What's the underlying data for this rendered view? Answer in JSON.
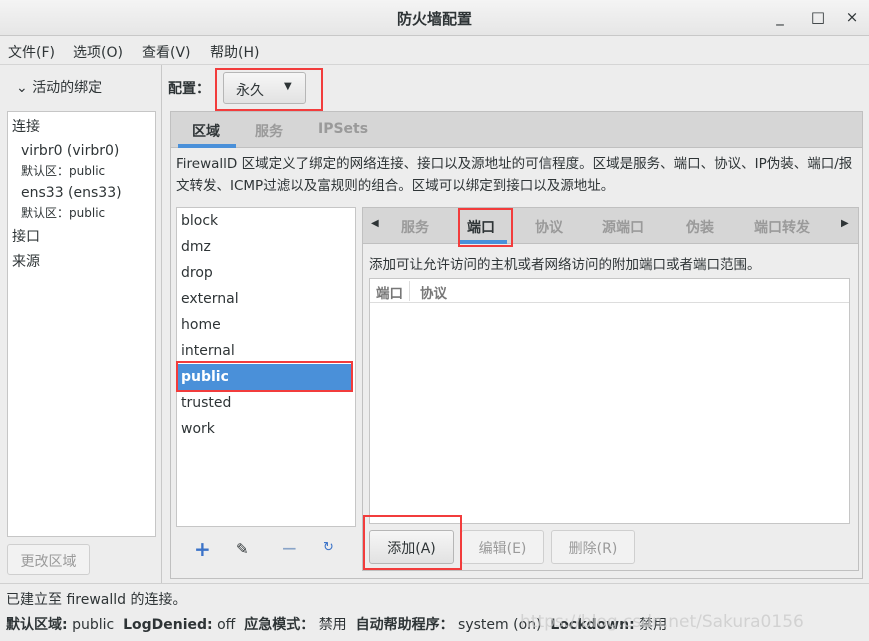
{
  "window": {
    "title": "防火墙配置",
    "controls": [
      "_",
      "□",
      "×"
    ]
  },
  "menu": [
    "文件(F)",
    "选项(O)",
    "查看(V)",
    "帮助(H)"
  ],
  "left": {
    "header": "活动的绑定",
    "section_connections": "连接",
    "connections": [
      {
        "name": "virbr0 (virbr0)",
        "zone_label": "默认区：",
        "zone": "public"
      },
      {
        "name": "ens33 (ens33)",
        "zone_label": "默认区：",
        "zone": "public"
      }
    ],
    "section_interfaces": "接口",
    "section_sources": "来源",
    "change_zone": "更改区域"
  },
  "config": {
    "label": "配置：",
    "value": "永久"
  },
  "main_tabs": [
    "区域",
    "服务",
    "IPSets"
  ],
  "description": "FirewallD 区域定义了绑定的网络连接、接口以及源地址的可信程度。区域是服务、端口、协议、IP伪装、端口/报文转发、ICMP过滤以及富规则的组合。区域可以绑定到接口以及源地址。",
  "zones": [
    "block",
    "dmz",
    "drop",
    "external",
    "home",
    "internal",
    "public",
    "trusted",
    "work"
  ],
  "selected_zone": "public",
  "zone_tabs": [
    "服务",
    "端口",
    "协议",
    "源端口",
    "伪装",
    "端口转发"
  ],
  "ports": {
    "description": "添加可让允许访问的主机或者网络访问的附加端口或者端口范围。",
    "columns": [
      "端口",
      "协议"
    ],
    "rows": [],
    "add": "添加(A)",
    "edit": "编辑(E)",
    "remove": "删除(R)"
  },
  "status": {
    "line1": "已建立至 firewalld 的连接。",
    "default_zone_label": "默认区域:",
    "default_zone": "public",
    "logdenied_label": "LogDenied:",
    "logdenied": "off",
    "panic_label": "应急模式：",
    "panic": "禁用",
    "helpers_label": "自动帮助程序：",
    "helpers": "system (on)",
    "lockdown_label": "Lockdown:",
    "lockdown": "禁用"
  },
  "watermark": "https://blog.csdn.net/Sakura0156"
}
